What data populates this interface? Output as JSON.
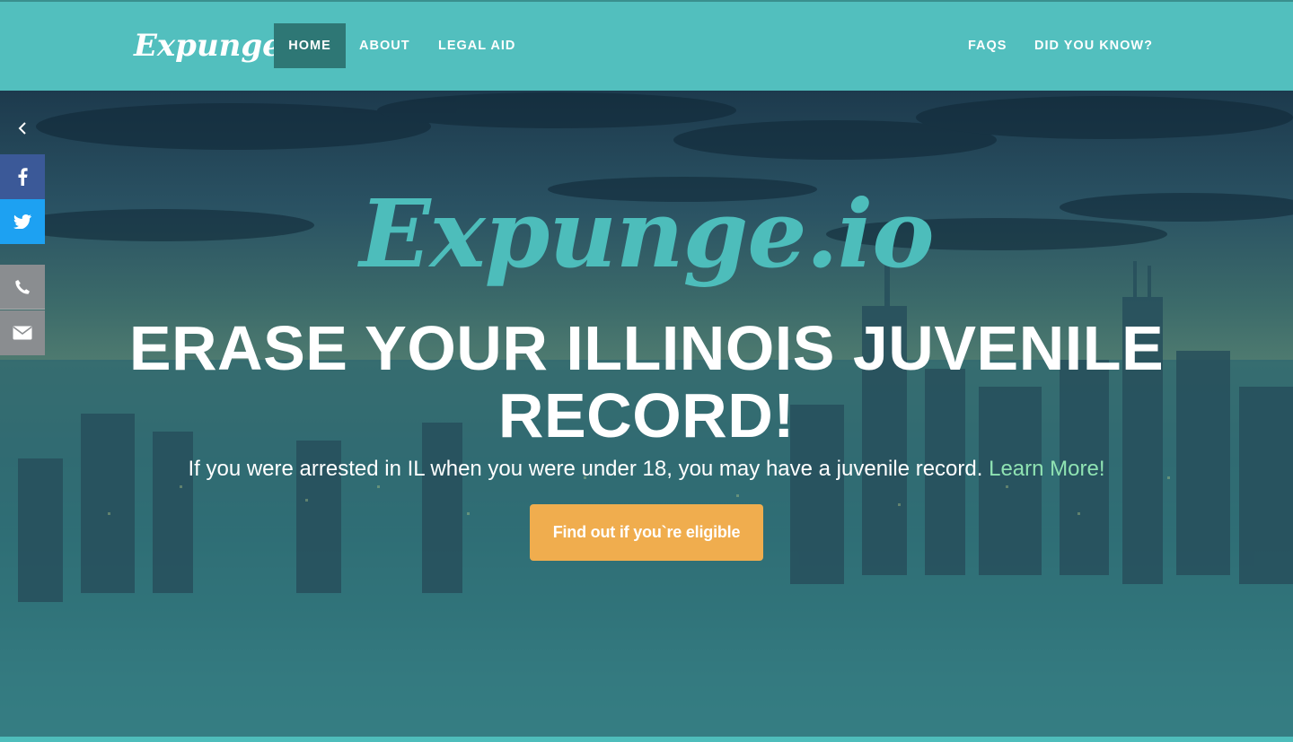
{
  "nav": {
    "logo": "Expunge.io",
    "items": [
      {
        "label": "HOME",
        "active": true
      },
      {
        "label": "ABOUT"
      },
      {
        "label": "LEGAL AID"
      },
      {
        "label": "FAQS"
      },
      {
        "label": "DID YOU KNOW?"
      }
    ]
  },
  "hero": {
    "logo": "Expunge.io",
    "title": "ERASE YOUR ILLINOIS JUVENILE RECORD!",
    "subtitle": "If you were arrested in IL when you were under 18, you may have a juvenile record.",
    "learn_more": "Learn More!",
    "cta": "Find out if you`re eligible"
  },
  "sidebar": {
    "toggle_icon": "chevron-left-icon",
    "buttons": [
      {
        "name": "facebook",
        "icon": "facebook-icon",
        "color": "#3b5998"
      },
      {
        "name": "twitter",
        "icon": "twitter-icon",
        "color": "#1da1f2"
      },
      {
        "name": "phone",
        "icon": "phone-icon",
        "color": "#8a8d90"
      },
      {
        "name": "email",
        "icon": "envelope-icon",
        "color": "#8a8d90"
      }
    ]
  },
  "colors": {
    "brand_teal": "#52bfbe",
    "nav_active": "#2e7775",
    "cta_orange": "#f0ad4e",
    "link_green": "#8fe2b2"
  }
}
